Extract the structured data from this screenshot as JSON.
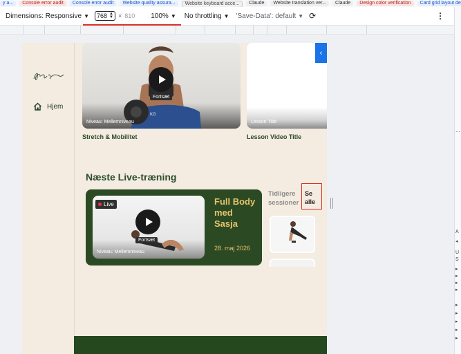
{
  "bookmarks": [
    {
      "label": "y a...",
      "style": "blue"
    },
    {
      "label": "Console error audit",
      "style": "red"
    },
    {
      "label": "Console error audit",
      "style": "blue"
    },
    {
      "label": "Website quality assura...",
      "style": "blue"
    },
    {
      "label": "Website keyboard acce...",
      "style": "gray"
    },
    {
      "label": "Claude",
      "style": "plain"
    },
    {
      "label": "Website translation ver...",
      "style": "plain"
    },
    {
      "label": "Claude",
      "style": "plain"
    },
    {
      "label": "Design color verification",
      "style": "red"
    },
    {
      "label": "Card grid layout de",
      "style": "blue"
    }
  ],
  "devtools": {
    "dimensions_label": "Dimensions: Responsive",
    "width_value": "768",
    "x_sign": "×",
    "height_value": "810",
    "zoom": "100%",
    "throttling": "No throttling",
    "save_data": "'Save-Data': default",
    "menu_icon": "vertical-dots",
    "rotate_icon": "rotate"
  },
  "right_strip": {
    "labels": [
      "A",
      "U",
      "S"
    ]
  },
  "page": {
    "nav": {
      "home_label": "Hjem",
      "home_icon": "home-icon"
    },
    "cards": [
      {
        "title": "Stretch & Mobilitet",
        "level": "Niveau: Mellemniveau",
        "continue": "Fortsæt",
        "kg": "KG"
      },
      {
        "title": "Lesson Video Title",
        "level": "Lesson Title"
      }
    ],
    "live_section": {
      "heading": "Næste Live-træning",
      "live_badge": "Live",
      "continue": "Fortsæt",
      "level": "Niveau: Mellemniveau",
      "title": "Full Body med Sasja",
      "date": "28. maj 2026"
    },
    "past_sessions": {
      "label": "Tidligere sessioner",
      "see_all": "Se alle"
    }
  },
  "colors": {
    "accent_blue": "#1a73e8",
    "brand_green": "#2b4a24",
    "brand_gold": "#e8c36a",
    "page_bg": "#f4ebe1",
    "highlight_red": "#d93025"
  }
}
